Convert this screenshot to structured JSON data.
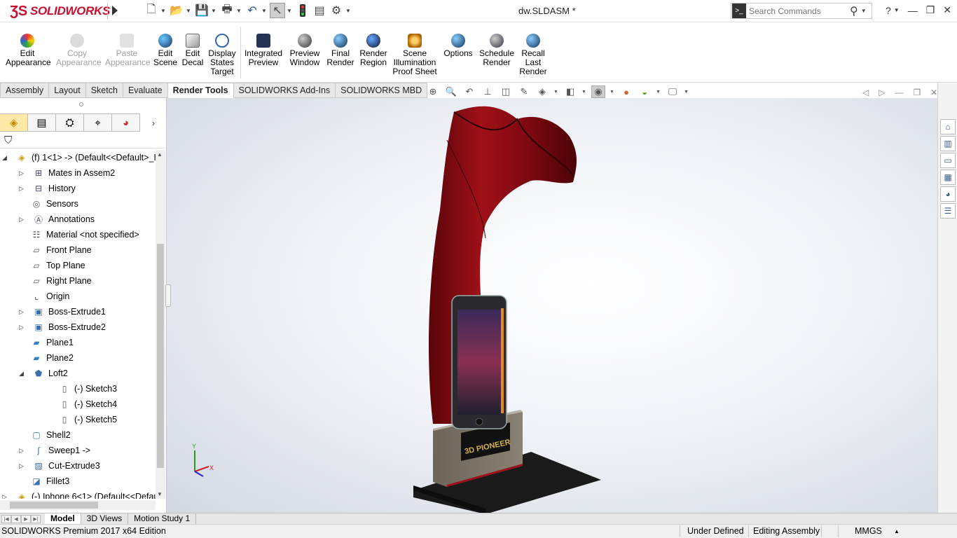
{
  "app": {
    "logo_text": "SOLIDWORKS",
    "document_title": "dw.SLDASM *"
  },
  "search": {
    "placeholder": "Search Commands"
  },
  "ribbon": {
    "buttons": [
      {
        "label": "Edit Appearance",
        "icon": "edit-appearance-icon",
        "enabled": true
      },
      {
        "label": "Copy Appearance",
        "icon": "copy-appearance-icon",
        "enabled": false
      },
      {
        "label": "Paste Appearance",
        "icon": "paste-appearance-icon",
        "enabled": false
      },
      {
        "label": "Edit Scene",
        "icon": "edit-scene-icon",
        "enabled": true
      },
      {
        "label": "Edit Decal",
        "icon": "edit-decal-icon",
        "enabled": true
      },
      {
        "label": "Display States Target",
        "icon": "display-states-target-icon",
        "enabled": true
      },
      {
        "label": "Integrated Preview",
        "icon": "integrated-preview-icon",
        "enabled": true
      },
      {
        "label": "Preview Window",
        "icon": "preview-window-icon",
        "enabled": true
      },
      {
        "label": "Final Render",
        "icon": "final-render-icon",
        "enabled": true
      },
      {
        "label": "Render Region",
        "icon": "render-region-icon",
        "enabled": true
      },
      {
        "label": "Scene Illumination Proof Sheet",
        "icon": "scene-illumination-icon",
        "enabled": true
      },
      {
        "label": "Options",
        "icon": "options-icon",
        "enabled": true
      },
      {
        "label": "Schedule Render",
        "icon": "schedule-render-icon",
        "enabled": true
      },
      {
        "label": "Recall Last Render",
        "icon": "recall-last-render-icon",
        "enabled": true
      }
    ]
  },
  "tabs": [
    "Assembly",
    "Layout",
    "Sketch",
    "Evaluate",
    "Render Tools",
    "SOLIDWORKS Add-Ins",
    "SOLIDWORKS MBD"
  ],
  "active_tab": "Render Tools",
  "tree": {
    "items": [
      {
        "label": "(f) 1<1> -> (Default<<Default>_I",
        "icon": "part-icon",
        "expander": "expanded"
      },
      {
        "label": "Mates in Assem2",
        "icon": "mates-icon",
        "expander": "collapsed"
      },
      {
        "label": "History",
        "icon": "history-icon",
        "expander": "collapsed"
      },
      {
        "label": "Sensors",
        "icon": "sensors-icon",
        "expander": "none"
      },
      {
        "label": "Annotations",
        "icon": "annotations-icon",
        "expander": "collapsed"
      },
      {
        "label": "Material <not specified>",
        "icon": "material-icon",
        "expander": "none"
      },
      {
        "label": "Front Plane",
        "icon": "plane-icon",
        "expander": "none"
      },
      {
        "label": "Top Plane",
        "icon": "plane-icon",
        "expander": "none"
      },
      {
        "label": "Right Plane",
        "icon": "plane-icon",
        "expander": "none"
      },
      {
        "label": "Origin",
        "icon": "origin-icon",
        "expander": "none"
      },
      {
        "label": "Boss-Extrude1",
        "icon": "extrude-icon",
        "expander": "collapsed"
      },
      {
        "label": "Boss-Extrude2",
        "icon": "extrude-icon",
        "expander": "collapsed"
      },
      {
        "label": "Plane1",
        "icon": "ref-plane-icon",
        "expander": "none"
      },
      {
        "label": "Plane2",
        "icon": "ref-plane-icon",
        "expander": "none"
      },
      {
        "label": "Loft2",
        "icon": "loft-icon",
        "expander": "expanded"
      },
      {
        "label": "(-) Sketch3",
        "icon": "sketch-icon",
        "expander": "none"
      },
      {
        "label": "(-) Sketch4",
        "icon": "sketch-icon",
        "expander": "none"
      },
      {
        "label": "(-) Sketch5",
        "icon": "sketch-icon",
        "expander": "none"
      },
      {
        "label": "Shell2",
        "icon": "shell-icon",
        "expander": "none"
      },
      {
        "label": "Sweep1 ->",
        "icon": "sweep-icon",
        "expander": "collapsed"
      },
      {
        "label": "Cut-Extrude3",
        "icon": "cut-extrude-icon",
        "expander": "collapsed"
      },
      {
        "label": "Fillet3",
        "icon": "fillet-icon",
        "expander": "none"
      },
      {
        "label": "(-) Iphone 6<1> (Default<<Defau",
        "icon": "part-icon",
        "expander": "collapsed"
      }
    ]
  },
  "bottom_tabs": [
    "Model",
    "3D Views",
    "Motion Study 1"
  ],
  "active_bottom_tab": "Model",
  "status": {
    "edition": "SOLIDWORKS Premium 2017 x64 Edition",
    "define_state": "Under Defined",
    "edit_mode": "Editing Assembly",
    "units": "MMGS"
  },
  "model": {
    "logo_text": "3D PIONEER"
  },
  "triad": {
    "x": "X",
    "y": "Y"
  },
  "colors": {
    "brand_red": "#c8102e",
    "horn_red": "#8b0a12",
    "base_gray": "#7d7468",
    "plate_black": "#1a1a1a"
  }
}
